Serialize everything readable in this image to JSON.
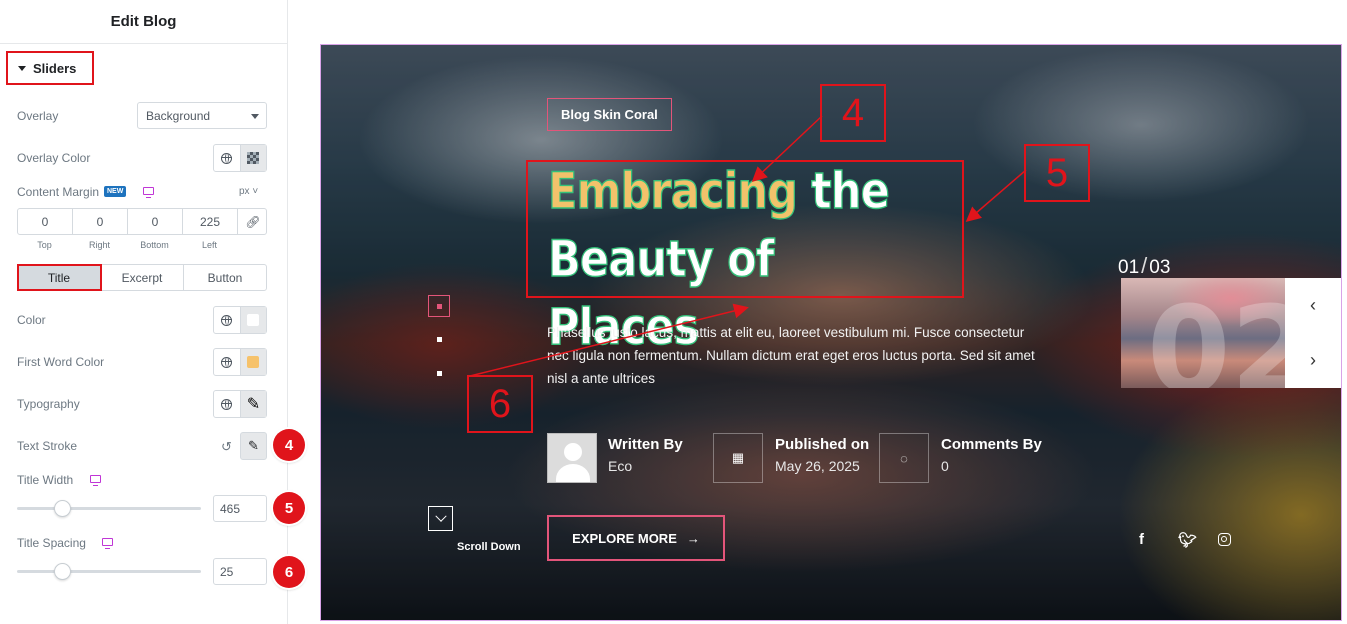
{
  "panel": {
    "title": "Edit Blog",
    "section_title": "Sliders",
    "overlay_label": "Overlay",
    "overlay_value": "Background",
    "overlay_color_label": "Overlay Color",
    "content_margin_label": "Content Margin",
    "new_badge": "NEW",
    "units": "px",
    "margin": {
      "top": "0",
      "right": "0",
      "bottom": "0",
      "left": "225"
    },
    "margin_labels": {
      "top": "Top",
      "right": "Right",
      "bottom": "Bottom",
      "left": "Left"
    },
    "tabs": [
      "Title",
      "Excerpt",
      "Button"
    ],
    "color_label": "Color",
    "first_word_color_label": "First Word Color",
    "typography_label": "Typography",
    "text_stroke_label": "Text Stroke",
    "title_width_label": "Title Width",
    "title_width_value": "465",
    "title_spacing_label": "Title Spacing",
    "title_spacing_value": "25",
    "step_badges": [
      "4",
      "5",
      "6"
    ],
    "colors": {
      "first_word_swatch": "#f6c26b",
      "color_swatch": "#ffffff"
    }
  },
  "preview": {
    "tag": "Blog Skin Coral",
    "title_first_word": "Embracing",
    "title_rest_line1": "the",
    "title_line2": "Beauty of Places",
    "description": "Phasellus justo lacus, mattis at elit eu, laoreet vestibulum mi. Fusce consectetur nec ligula non fermentum. Nullam dictum erat eget eros luctus porta. Sed sit amet nisl a ante ultrices",
    "author_heading": "Written By",
    "author_name": "Eco",
    "published_heading": "Published on",
    "published_date": "May 26, 2025",
    "comments_heading": "Comments By",
    "comments_count": "0",
    "explore_label": "EXPLORE MORE",
    "explore_arrow": "→",
    "scroll_label": "Scroll Down",
    "counter_current": "01",
    "counter_total": "03",
    "thumb_numeral": "02",
    "prev_arrow": "‹",
    "next_arrow": "›",
    "social": [
      "f",
      "t",
      "ig"
    ]
  },
  "annotations": [
    "4",
    "5",
    "6"
  ],
  "colors": {
    "accent": "#e3557a",
    "annotation_red": "#e0141b",
    "title_stroke": "#34c17a",
    "first_word": "#f2c26b"
  }
}
